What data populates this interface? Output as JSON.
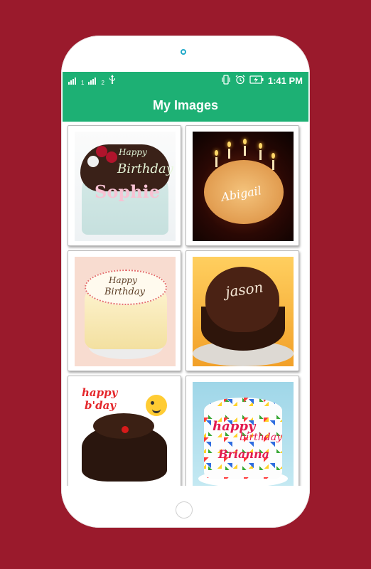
{
  "device": {
    "bezel_color": "#9a1a2c",
    "accent_color": "#1db074"
  },
  "status_bar": {
    "sim1_label": "1",
    "sim2_label": "2",
    "time": "1:41 PM",
    "icons": [
      "signal-icon",
      "usb-icon",
      "vibrate-icon",
      "alarm-icon",
      "battery-charging-icon"
    ]
  },
  "app_bar": {
    "title": "My Images"
  },
  "gallery": {
    "items": [
      {
        "image": "birthday-cake-image",
        "text1": "Happy",
        "text2": "Birthday",
        "name": "Sophie"
      },
      {
        "image": "candle-cake-image",
        "name": "Abigail"
      },
      {
        "image": "vanilla-cake-image",
        "text1": "Happy",
        "text2": "Birthday"
      },
      {
        "image": "heart-cake-image",
        "name": "jason"
      },
      {
        "image": "chocolate-cake-image",
        "text1": "happy",
        "text2": "b'day"
      },
      {
        "image": "colorful-cake-image",
        "text1": "happy",
        "text2": "birthday",
        "name": "Brianna"
      }
    ]
  }
}
